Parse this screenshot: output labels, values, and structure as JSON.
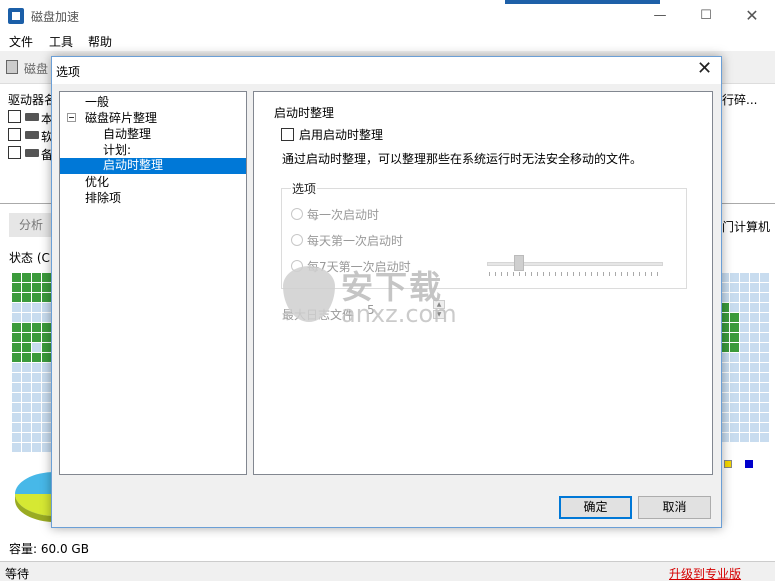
{
  "app": {
    "title": "磁盘加速",
    "window_min": "—",
    "window_max": "☐",
    "window_close": "✕"
  },
  "menu": [
    "文件",
    "工具",
    "帮助"
  ],
  "toolbar": {
    "label": "磁盘"
  },
  "drives": {
    "header_left": "驱动器名",
    "header_right": "行碎...",
    "rows": [
      "本",
      "软",
      "备"
    ]
  },
  "analyze": {
    "button": "分析",
    "computer": "门计算机"
  },
  "status": {
    "label": "状态 (C:",
    "capacity": "容量: 60.0 GB",
    "bar_text": "等待",
    "upgrade": "升级到专业版"
  },
  "dialog": {
    "title": "选项",
    "close": "✕",
    "tree": {
      "general": "一般",
      "defrag": "磁盘碎片整理",
      "autodefrag": "自动整理",
      "schedule": "计划:",
      "boottime": "启动时整理",
      "optimize": "优化",
      "exclusions": "排除项"
    },
    "content": {
      "title": "启动时整理",
      "enable_label": "启用启动时整理",
      "description": "通过启动时整理，可以整理那些在系统运行时无法安全移动的文件。",
      "options_legend": "选项",
      "radio_each": "每一次启动时",
      "radio_daily": "每天第一次启动时",
      "radio_every_n": "每7天第一次启动时",
      "maxlog_label": "最大日志文件",
      "maxlog_value": "5"
    },
    "ok": "确定",
    "cancel": "取消"
  },
  "watermark": {
    "cn": "安下载",
    "en": "anxz.com"
  },
  "colors": {
    "accent": "#0078d7",
    "used_block": "#3b9b3b",
    "free_block": "#c8dcef",
    "upgrade": "#d40000"
  }
}
